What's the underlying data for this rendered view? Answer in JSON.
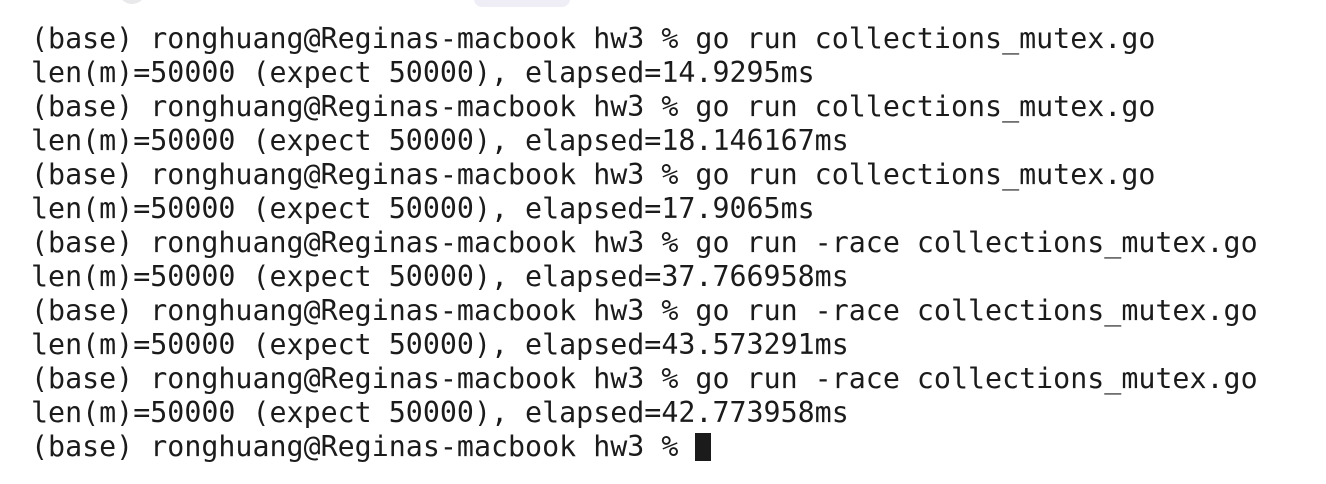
{
  "terminal": {
    "prompt": "(base) ronghuang@Reginas-macbook hw3 % ",
    "lines": [
      {
        "kind": "command",
        "command": "go run collections_mutex.go"
      },
      {
        "kind": "output",
        "text": "len(m)=50000 (expect 50000), elapsed=14.9295ms"
      },
      {
        "kind": "command",
        "command": "go run collections_mutex.go"
      },
      {
        "kind": "output",
        "text": "len(m)=50000 (expect 50000), elapsed=18.146167ms"
      },
      {
        "kind": "command",
        "command": "go run collections_mutex.go"
      },
      {
        "kind": "output",
        "text": "len(m)=50000 (expect 50000), elapsed=17.9065ms"
      },
      {
        "kind": "command",
        "command": "go run -race collections_mutex.go"
      },
      {
        "kind": "output",
        "text": "len(m)=50000 (expect 50000), elapsed=37.766958ms"
      },
      {
        "kind": "command",
        "command": "go run -race collections_mutex.go"
      },
      {
        "kind": "output",
        "text": "len(m)=50000 (expect 50000), elapsed=43.573291ms"
      },
      {
        "kind": "command",
        "command": "go run -race collections_mutex.go"
      },
      {
        "kind": "output",
        "text": "len(m)=50000 (expect 50000), elapsed=42.773958ms"
      },
      {
        "kind": "command",
        "command": ""
      }
    ],
    "colors": {
      "background": "#ffffff",
      "text": "#1b1b1b",
      "cursor": "#1b1b1b"
    }
  }
}
